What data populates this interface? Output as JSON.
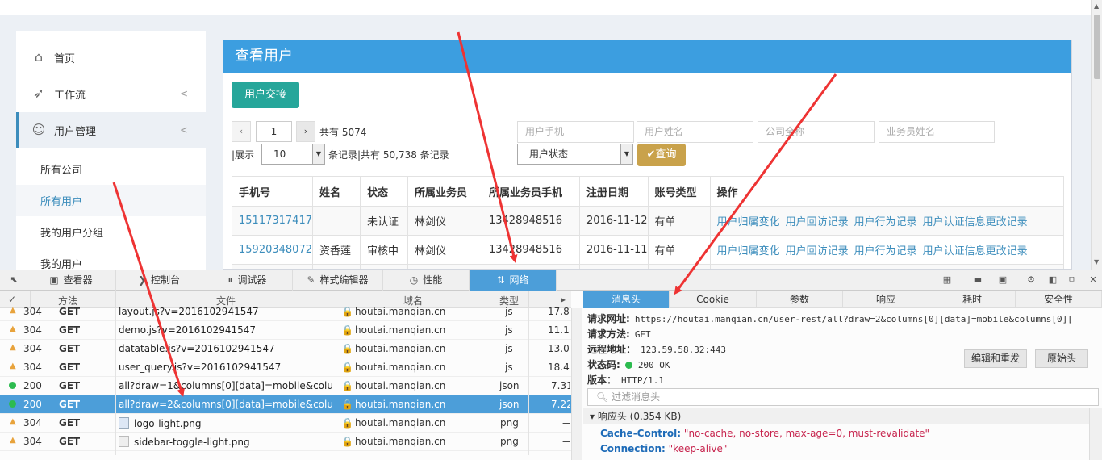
{
  "sidebar": {
    "items": [
      {
        "label": "首页",
        "icon": "home-icon"
      },
      {
        "label": "工作流",
        "icon": "rocket-icon"
      },
      {
        "label": "用户管理",
        "icon": "users-icon"
      }
    ],
    "sub_items": [
      "所有公司",
      "所有用户",
      "我的用户分组",
      "我的用户"
    ]
  },
  "panel": {
    "title": "查看用户",
    "transfer_button": "用户交接",
    "page_prev": "‹",
    "page_next": "›",
    "page_value": "1",
    "total_pages": "共有 5074",
    "show_label": "|展示",
    "page_size": "10",
    "records_info": "条记录|共有 50,738 条记录",
    "filters": {
      "phone_placeholder": "用户手机",
      "name_placeholder": "用户姓名",
      "company_placeholder": "公司全称",
      "agent_placeholder": "业务员姓名",
      "status_select": "用户状态"
    },
    "query_button": "✔查询",
    "table": {
      "headers": [
        "手机号",
        "姓名",
        "状态",
        "所属业务员",
        "所属业务员手机",
        "注册日期",
        "账号类型",
        "操作"
      ],
      "rows": [
        {
          "phone": "15117317417",
          "name": "",
          "status": "未认证",
          "agent": "林剑仪",
          "agent_phone": "13428948516",
          "date": "2016-11-12",
          "type": "有单"
        },
        {
          "phone": "15920348072",
          "name": "资香莲",
          "status": "审核中",
          "agent": "林剑仪",
          "agent_phone": "13428948516",
          "date": "2016-11-11",
          "type": "有单"
        }
      ],
      "ops": [
        "用户归属变化",
        "用户回访记录",
        "用户行为记录",
        "用户认证信息更改记录"
      ]
    }
  },
  "devtools": {
    "tabs": [
      "查看器",
      "控制台",
      "调试器",
      "样式编辑器",
      "性能",
      "网络"
    ],
    "columns": [
      "✓",
      "方法",
      "文件",
      "域名",
      "类型"
    ],
    "requests": [
      {
        "status": "304",
        "method": "GET",
        "file": "layout.js?v=2016102941547",
        "domain": "houtai.manqian.cn",
        "type": "js",
        "size": "17.82"
      },
      {
        "status": "304",
        "method": "GET",
        "file": "demo.js?v=2016102941547",
        "domain": "houtai.manqian.cn",
        "type": "js",
        "size": "11.10"
      },
      {
        "status": "304",
        "method": "GET",
        "file": "datatable.js?v=2016102941547",
        "domain": "houtai.manqian.cn",
        "type": "js",
        "size": "13.08"
      },
      {
        "status": "304",
        "method": "GET",
        "file": "user_query.js?v=2016102941547",
        "domain": "houtai.manqian.cn",
        "type": "js",
        "size": "18.47"
      },
      {
        "status": "200",
        "method": "GET",
        "file": "all?draw=1&columns[0][data]=mobile&colu...",
        "domain": "houtai.manqian.cn",
        "type": "json",
        "size": "7.31"
      },
      {
        "status": "200",
        "method": "GET",
        "file": "all?draw=2&columns[0][data]=mobile&colu...",
        "domain": "houtai.manqian.cn",
        "type": "json",
        "size": "7.22"
      },
      {
        "status": "304",
        "method": "GET",
        "file": "logo-light.png",
        "domain": "houtai.manqian.cn",
        "type": "png",
        "size": "—"
      },
      {
        "status": "304",
        "method": "GET",
        "file": "sidebar-toggle-light.png",
        "domain": "houtai.manqian.cn",
        "type": "png",
        "size": "—"
      }
    ],
    "detail_tabs": [
      "消息头",
      "Cookie",
      "参数",
      "响应",
      "耗时",
      "安全性"
    ],
    "detail": {
      "url_label": "请求网址:",
      "url": "https://houtai.manqian.cn/user-rest/all?draw=2&columns[0][data]=mobile&columns[0][",
      "method_label": "请求方法:",
      "method": "GET",
      "remote_label": "远程地址：",
      "remote": "123.59.58.32:443",
      "status_label": "状态码:",
      "status": "200 OK",
      "version_label": "版本：",
      "version": "HTTP/1.1",
      "edit_resend": "编辑和重发",
      "raw_headers": "原始头",
      "filter_placeholder": "过滤消息头",
      "response_headers": "响应头 (0.354 KB)",
      "headers": [
        {
          "key": "Cache-Control:",
          "value": "\"no-cache, no-store, max-age=0, must-revalidate\""
        },
        {
          "key": "Connection:",
          "value": "\"keep-alive\""
        }
      ]
    }
  },
  "colors": {
    "accent": "#3c9ee0",
    "teal": "#26a69a",
    "gold": "#c9a24b",
    "devtools_selected": "#4c9ed9",
    "arrow": "#ee3333"
  }
}
